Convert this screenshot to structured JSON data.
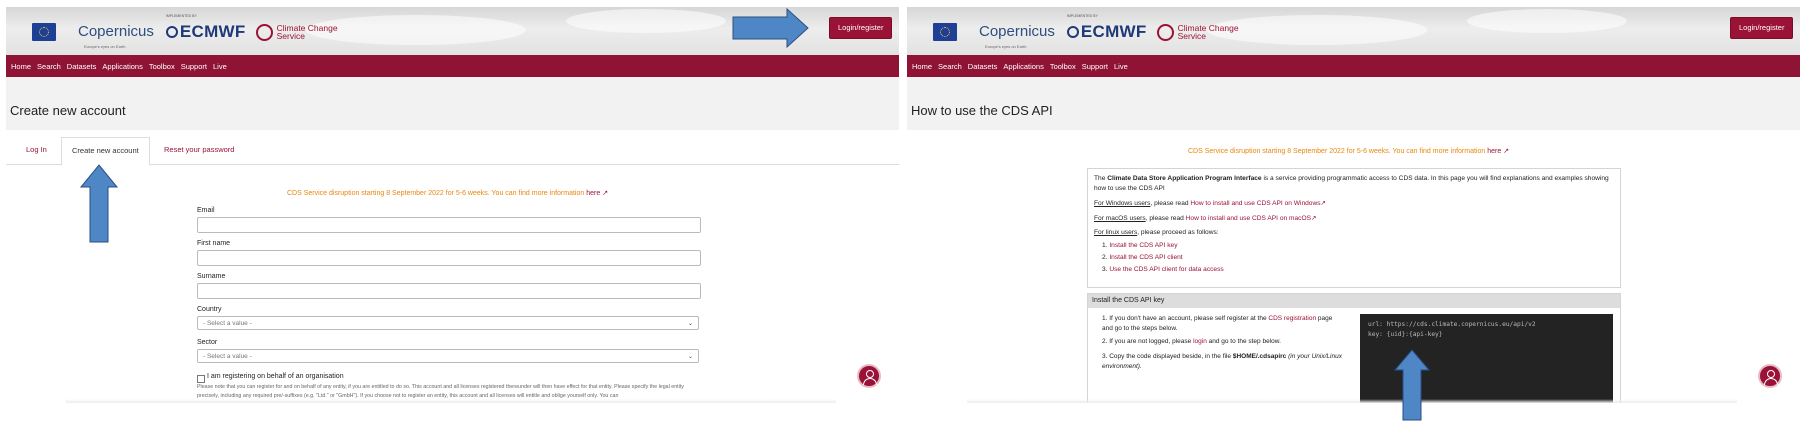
{
  "header": {
    "logo_copernicus": "Copernicus",
    "logo_copernicus_sub": "Europe's eyes on Earth",
    "logo_implemented": "IMPLEMENTED BY",
    "logo_ecmwf": "ECMWF",
    "logo_c3s_line1": "Climate Change",
    "logo_c3s_line2": "Service",
    "login_label": "Login/register"
  },
  "nav": [
    "Home",
    "Search",
    "Datasets",
    "Applications",
    "Toolbox",
    "Support",
    "Live"
  ],
  "left": {
    "page_title": "Create new account",
    "tabs": [
      "Log In",
      "Create new account",
      "Reset your password"
    ],
    "notice_text": "CDS Service disruption starting 8 September 2022 for 5-6 weeks. You can find more information",
    "notice_link": "here",
    "form": {
      "email_label": "Email",
      "first_name_label": "First name",
      "surname_label": "Surname",
      "country_label": "Country",
      "country_value": "- Select a value -",
      "sector_label": "Sector",
      "sector_value": "- Select a value -",
      "org_checkbox_label": "I am registering on behalf of an organisation",
      "org_note": "Please note that you can register for and on behalf of any entity, if you are entitled to do so. This account and all licenses registered thereunder will then have effect for that entity. Please specify the legal entity precisely, including any required pre/-suffixes (e.g. \"Ltd.\" or \"GmbH\"). If you choose not to register an entity, this account and all licenses will entitle and oblige yourself only. You can"
    }
  },
  "right": {
    "page_title": "How to use the CDS API",
    "notice_text": "CDS Service disruption starting 8 September 2022 for 5-6 weeks. You can find more information",
    "notice_link": "here",
    "intro_pre": "The",
    "intro_bold": "Climate Data Store Application Program Interface",
    "intro_post": "is a service providing programmatic access to CDS data. In this page you will find explanations and examples showing how to use the CDS API",
    "windows_label": "For Windows users",
    "windows_text": ", please read",
    "windows_link": "How to install and use CDS API on Windows",
    "macos_label": "For macOS users",
    "macos_text": ", please read",
    "macos_link": "How to install and use CDS API on macOS",
    "linux_label": "For linux users",
    "linux_text": ", please proceed as follows:",
    "steps": [
      "Install the CDS API key",
      "Install the CDS API client",
      "Use the CDS API client for data access"
    ],
    "section_title": "Install the CDS API key",
    "key_step1_pre": "If you don't have an account, please self register at the",
    "key_step1_link": "CDS registration",
    "key_step1_post": "page and go to the steps below.",
    "key_step2_pre": "If you are not logged, please",
    "key_step2_link": "login",
    "key_step2_post": "and go to the step below.",
    "key_step3_pre": "Copy the code displayed beside, in the file",
    "key_step3_file": "$HOME/.cdsapirc",
    "key_step3_post": "(in your Unix/Linux environment).",
    "code_url": "url: https://cds.climate.copernicus.eu/api/v2",
    "code_key": "key: {uid}:{api-key}"
  },
  "colors": {
    "brand": "#9a1235",
    "nav": "#8f1335",
    "notice": "#e8870e",
    "arrow": "#4f86c6"
  }
}
